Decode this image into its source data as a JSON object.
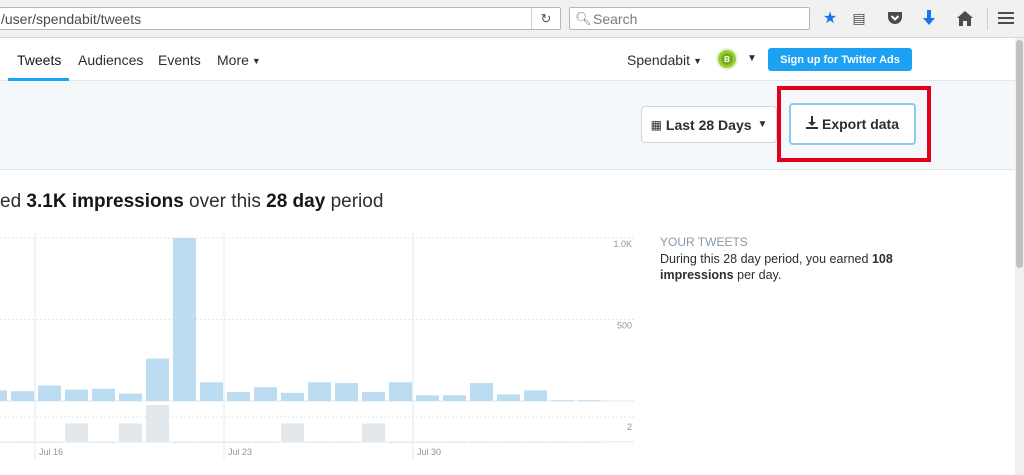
{
  "browser": {
    "url": "/user/spendabit/tweets",
    "search_placeholder": "Search"
  },
  "nav": {
    "tabs": [
      "Tweets",
      "Audiences",
      "Events",
      "More"
    ],
    "account": "Spendabit",
    "ads_button": "Sign up for Twitter Ads"
  },
  "toolbar": {
    "date_range": "Last 28 Days",
    "export_label": "Export data"
  },
  "summary": {
    "prefix": "ed ",
    "impressions": "3.1K impressions",
    "middle": " over this ",
    "period": "28 day",
    "suffix": " period"
  },
  "side": {
    "title": "YOUR TWEETS",
    "text_prefix": "During this 28 day period, you earned ",
    "value": "108",
    "text_suffix": "impressions",
    "text_end": " per day."
  },
  "chart_data": {
    "type": "bar",
    "y_ticks": [
      "1.0K",
      "500"
    ],
    "ylim": [
      0,
      1000
    ],
    "impressions": [
      65,
      60,
      95,
      70,
      75,
      45,
      260,
      1000,
      115,
      55,
      85,
      50,
      115,
      110,
      55,
      115,
      35,
      35,
      110,
      40,
      65,
      5,
      5
    ],
    "secondary_ticks": [
      "2"
    ],
    "secondary_ylim": [
      0,
      2
    ],
    "secondary": [
      0,
      0,
      0,
      1,
      0,
      1,
      2,
      0,
      0,
      0,
      0,
      1,
      0,
      0,
      1,
      0,
      0,
      0,
      0,
      0,
      0,
      0,
      0
    ],
    "x_labels": [
      "Jul 16",
      "Jul 23",
      "Jul 30"
    ],
    "colors": {
      "primary": "#bcdcf2",
      "secondary": "#e3e8ec"
    }
  }
}
